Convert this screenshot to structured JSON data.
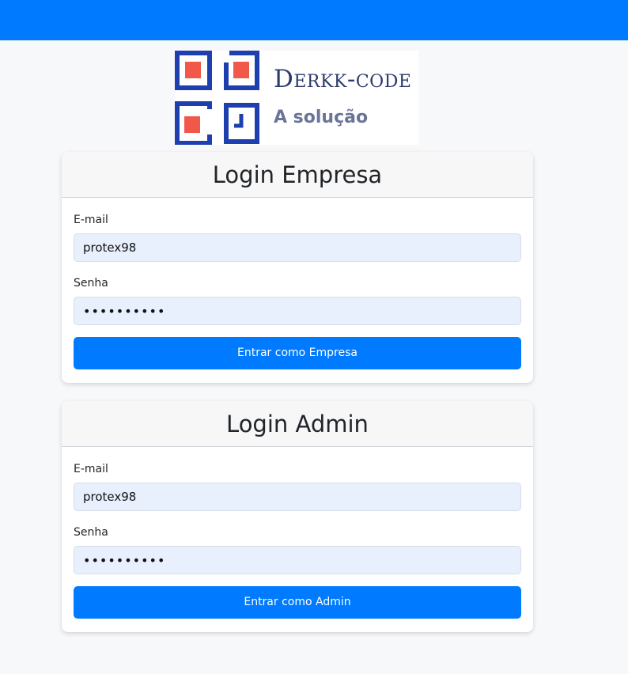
{
  "logo": {
    "title": "Derkk-code",
    "subtitle": "A solução"
  },
  "empresa": {
    "title": "Login Empresa",
    "email_label": "E-mail",
    "email_value": "protex98",
    "password_label": "Senha",
    "password_value": "••••••••••",
    "button_label": "Entrar como Empresa"
  },
  "admin": {
    "title": "Login Admin",
    "email_label": "E-mail",
    "email_value": "protex98",
    "password_label": "Senha",
    "password_value": "••••••••••",
    "button_label": "Entrar como Admin"
  },
  "colors": {
    "primary": "#007bff",
    "input_autofill": "#e8f0fe",
    "logo_blue": "#1e3fae",
    "logo_red": "#f2584a"
  },
  "icons": [
    "derkk-code-logo-icon"
  ]
}
